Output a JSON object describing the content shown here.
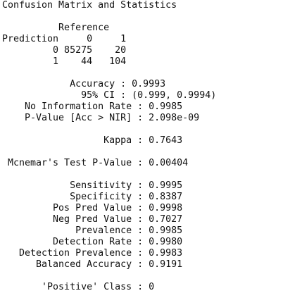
{
  "console": {
    "title": "Confusion Matrix and Statistics",
    "matrix": {
      "reference_header": "          Reference",
      "header_row": "Prediction     0     1",
      "row_0": "         0 85275    20",
      "row_1": "         1    44   104"
    },
    "stats": {
      "accuracy": "            Accuracy : 0.9993",
      "ci": "              95% CI : (0.999, 0.9994)",
      "nir": "    No Information Rate : 0.9985",
      "pvalue": "    P-Value [Acc > NIR] : 2.098e-09",
      "kappa": "                  Kappa : 0.7643",
      "mcnemar": " Mcnemar's Test P-Value : 0.00404",
      "sensitivity": "            Sensitivity : 0.9995",
      "specificity": "            Specificity : 0.8387",
      "pos_pred": "         Pos Pred Value : 0.9998",
      "neg_pred": "         Neg Pred Value : 0.7027",
      "prevalence": "             Prevalence : 0.9985",
      "detection_rate": "         Detection Rate : 0.9980",
      "detection_prevalence": "   Detection Prevalence : 0.9983",
      "balanced_accuracy": "      Balanced Accuracy : 0.9191",
      "positive_class": "       'Positive' Class : 0"
    }
  }
}
